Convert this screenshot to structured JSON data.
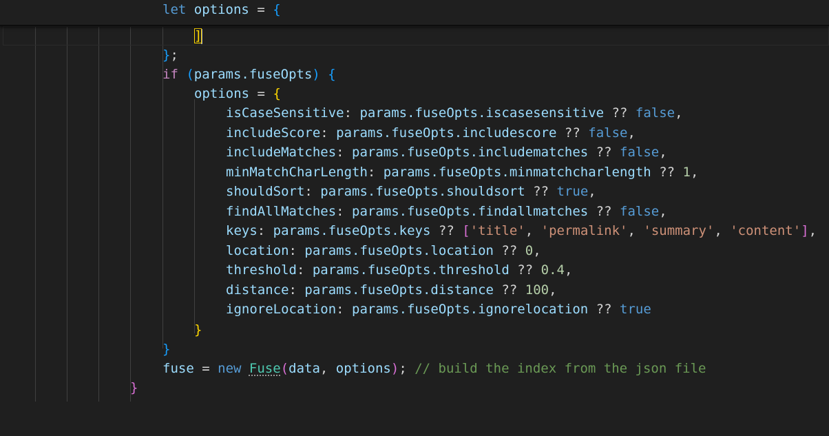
{
  "sticky": {
    "kw": "let",
    "name": "options",
    "op": "=",
    "brace": "{"
  },
  "lines": {
    "l1": {
      "bracket": "]"
    },
    "l2": {
      "brace": "}",
      "semi": ";"
    },
    "l3": {
      "kw": "if",
      "open": "(",
      "expr": "params.fuseOpts",
      "close": ")",
      "brace": "{"
    },
    "l4": {
      "name": "options",
      "op": "=",
      "brace": "{"
    },
    "props": [
      {
        "key": "isCaseSensitive",
        "path": "params.fuseOpts.iscasesensitive",
        "op": "??",
        "val": "false",
        "type": "kw",
        "comma": ","
      },
      {
        "key": "includeScore",
        "path": "params.fuseOpts.includescore",
        "op": "??",
        "val": "false",
        "type": "kw",
        "comma": ","
      },
      {
        "key": "includeMatches",
        "path": "params.fuseOpts.includematches",
        "op": "??",
        "val": "false",
        "type": "kw",
        "comma": ","
      },
      {
        "key": "minMatchCharLength",
        "path": "params.fuseOpts.minmatchcharlength",
        "op": "??",
        "val": "1",
        "type": "num",
        "comma": ","
      },
      {
        "key": "shouldSort",
        "path": "params.fuseOpts.shouldsort",
        "op": "??",
        "val": "true",
        "type": "kw",
        "comma": ","
      },
      {
        "key": "findAllMatches",
        "path": "params.fuseOpts.findallmatches",
        "op": "??",
        "val": "false",
        "type": "kw",
        "comma": ","
      },
      {
        "key": "keys",
        "path": "params.fuseOpts.keys",
        "op": "??",
        "type": "arr",
        "items": [
          "'title'",
          "'permalink'",
          "'summary'",
          "'content'"
        ],
        "comma": ","
      },
      {
        "key": "location",
        "path": "params.fuseOpts.location",
        "op": "??",
        "val": "0",
        "type": "num",
        "comma": ","
      },
      {
        "key": "threshold",
        "path": "params.fuseOpts.threshold",
        "op": "??",
        "val": "0.4",
        "type": "num",
        "comma": ","
      },
      {
        "key": "distance",
        "path": "params.fuseOpts.distance",
        "op": "??",
        "val": "100",
        "type": "num",
        "comma": ","
      },
      {
        "key": "ignoreLocation",
        "path": "params.fuseOpts.ignorelocation",
        "op": "??",
        "val": "true",
        "type": "kw",
        "comma": ""
      }
    ],
    "l16": {
      "brace": "}"
    },
    "l17": {
      "brace": "}"
    },
    "l18": {
      "name": "fuse",
      "op": "=",
      "kw": "new",
      "cls": "Fuse",
      "open": "(",
      "arg1": "data",
      "comma": ",",
      "arg2": "options",
      "close": ")",
      "semi": ";",
      "comment": "// build the index from the json file"
    },
    "l19": {
      "brace": "}"
    }
  }
}
